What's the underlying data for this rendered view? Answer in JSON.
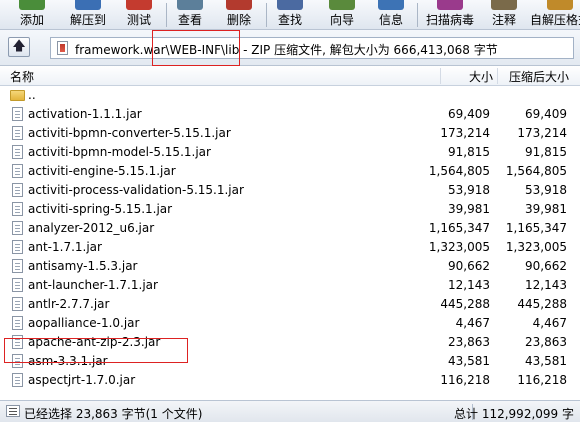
{
  "toolbar": {
    "buttons": [
      {
        "label": "添加",
        "color": "#4a8d3a"
      },
      {
        "label": "解压到",
        "color": "#3b6fb4"
      },
      {
        "label": "测试",
        "color": "#c43b2f"
      },
      {
        "label": "查看",
        "color": "#5c7f9a"
      },
      {
        "label": "删除",
        "color": "#b33a2e"
      },
      {
        "label": "查找",
        "color": "#4b6aa1"
      },
      {
        "label": "向导",
        "color": "#5a8a3c"
      },
      {
        "label": "信息",
        "color": "#3d73b5"
      },
      {
        "label": "扫描病毒",
        "color": "#9a3a8c"
      },
      {
        "label": "注释",
        "color": "#7a6a4a"
      },
      {
        "label": "自解压格式",
        "color": "#c08a2a"
      }
    ]
  },
  "address": {
    "path": "framework.war\\WEB-INF\\lib - ZIP 压缩文件, 解包大小为 666,413,068 字节"
  },
  "columns": {
    "name": "名称",
    "size": "大小",
    "packed": "压缩后大小"
  },
  "files": [
    {
      "name": "..",
      "size": "",
      "packed": "",
      "type": "folder"
    },
    {
      "name": "activation-1.1.1.jar",
      "size": "69,409",
      "packed": "69,409"
    },
    {
      "name": "activiti-bpmn-converter-5.15.1.jar",
      "size": "173,214",
      "packed": "173,214"
    },
    {
      "name": "activiti-bpmn-model-5.15.1.jar",
      "size": "91,815",
      "packed": "91,815"
    },
    {
      "name": "activiti-engine-5.15.1.jar",
      "size": "1,564,805",
      "packed": "1,564,805"
    },
    {
      "name": "activiti-process-validation-5.15.1.jar",
      "size": "53,918",
      "packed": "53,918"
    },
    {
      "name": "activiti-spring-5.15.1.jar",
      "size": "39,981",
      "packed": "39,981"
    },
    {
      "name": "analyzer-2012_u6.jar",
      "size": "1,165,347",
      "packed": "1,165,347"
    },
    {
      "name": "ant-1.7.1.jar",
      "size": "1,323,005",
      "packed": "1,323,005"
    },
    {
      "name": "antisamy-1.5.3.jar",
      "size": "90,662",
      "packed": "90,662"
    },
    {
      "name": "ant-launcher-1.7.1.jar",
      "size": "12,143",
      "packed": "12,143"
    },
    {
      "name": "antlr-2.7.7.jar",
      "size": "445,288",
      "packed": "445,288"
    },
    {
      "name": "aopalliance-1.0.jar",
      "size": "4,467",
      "packed": "4,467"
    },
    {
      "name": "apache-ant-zip-2.3.jar",
      "size": "23,863",
      "packed": "23,863"
    },
    {
      "name": "asm-3.3.1.jar",
      "size": "43,581",
      "packed": "43,581"
    },
    {
      "name": "aspectjrt-1.7.0.jar",
      "size": "116,218",
      "packed": "116,218"
    }
  ],
  "status": {
    "selected": "已经选择 23,863 字节(1 个文件)",
    "total": "总计 112,992,099 字"
  },
  "colors": {
    "highlight": "#dd2222"
  }
}
